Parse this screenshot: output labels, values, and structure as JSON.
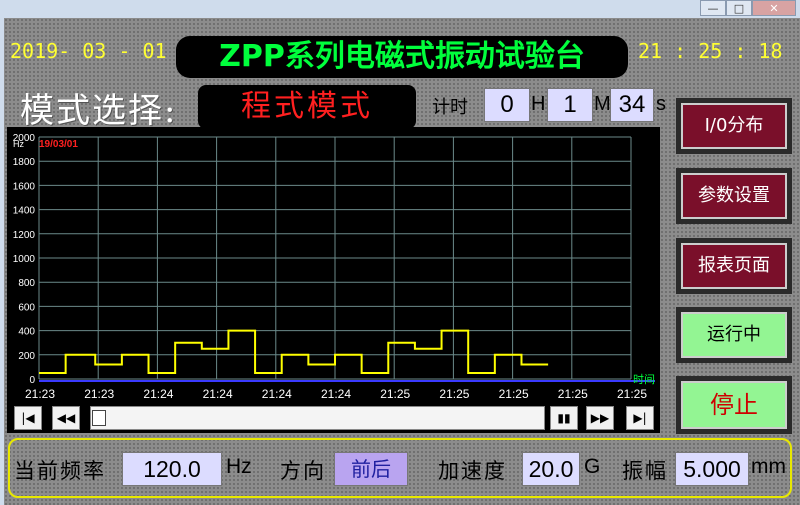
{
  "window": {
    "min_glyph": "—",
    "max_glyph": "□",
    "close_glyph": "✕"
  },
  "header": {
    "date": "2019- 03 - 01",
    "title": "ZPP系列电磁式振动试验台",
    "time": "21 : 25 : 18"
  },
  "mode": {
    "label": "模式选择:",
    "value": "程式模式"
  },
  "timer": {
    "label": "计时",
    "hours": "0",
    "hours_unit": "H",
    "minutes": "1",
    "minutes_unit": "M",
    "seconds": "34",
    "seconds_unit": "s"
  },
  "chart_data": {
    "type": "line",
    "ylabel": "Hz",
    "xlabel": "时间",
    "date_tag": "19/03/01",
    "ylim": [
      0,
      2000
    ],
    "yticks": [
      "2000",
      "1800",
      "1600",
      "1400",
      "1200",
      "1000",
      "800",
      "600",
      "400",
      "200",
      "0"
    ],
    "xticks": [
      "21:23",
      "21:23",
      "21:24",
      "21:24",
      "21:24",
      "21:24",
      "21:25",
      "21:25",
      "21:25",
      "21:25",
      "21:25"
    ],
    "grid": true,
    "line_color": "#ffff00",
    "series": [
      {
        "values": [
          [
            0,
            50
          ],
          [
            0.45,
            50
          ],
          [
            0.45,
            200
          ],
          [
            0.95,
            200
          ],
          [
            0.95,
            120
          ],
          [
            1.4,
            120
          ],
          [
            1.4,
            200
          ],
          [
            1.85,
            200
          ],
          [
            1.85,
            50
          ],
          [
            2.3,
            50
          ],
          [
            2.3,
            300
          ],
          [
            2.75,
            300
          ],
          [
            2.75,
            250
          ],
          [
            3.2,
            250
          ],
          [
            3.2,
            400
          ],
          [
            3.65,
            400
          ],
          [
            3.65,
            50
          ],
          [
            4.1,
            50
          ],
          [
            4.1,
            200
          ],
          [
            4.55,
            200
          ],
          [
            4.55,
            120
          ],
          [
            5.0,
            120
          ],
          [
            5.0,
            200
          ],
          [
            5.45,
            200
          ],
          [
            5.45,
            50
          ],
          [
            5.9,
            50
          ],
          [
            5.9,
            300
          ],
          [
            6.35,
            300
          ],
          [
            6.35,
            250
          ],
          [
            6.8,
            250
          ],
          [
            6.8,
            400
          ],
          [
            7.25,
            400
          ],
          [
            7.25,
            50
          ],
          [
            7.7,
            50
          ],
          [
            7.7,
            200
          ],
          [
            8.15,
            200
          ],
          [
            8.15,
            120
          ],
          [
            8.6,
            120
          ]
        ]
      }
    ],
    "xlim": [
      0,
      10
    ]
  },
  "chart_controls": {
    "first": "|◀",
    "rewind": "◀◀",
    "pause": "▮▮",
    "forward": "▶▶",
    "last": "▶|"
  },
  "side_buttons": {
    "io": "I/0分布",
    "params": "参数设置",
    "report": "报表页面",
    "status": "运行中",
    "stop": "停止"
  },
  "bottom": {
    "freq_label": "当前频率",
    "freq_value": "120.0",
    "freq_unit": "Hz",
    "dir_label": "方向",
    "dir_value": "前后",
    "accel_label": "加速度",
    "accel_value": "20.0",
    "accel_unit": "G",
    "amp_label": "振幅",
    "amp_value": "5.000",
    "amp_unit": "mm"
  },
  "colors": {
    "panel": "#8c8c8c",
    "title_green": "#00ff3c",
    "mode_red": "#ff2020",
    "header_yellow": "#ffff33",
    "button_maroon": "#7a0f2a",
    "button_green": "#93f593",
    "input_lavender": "#dcdcff"
  }
}
